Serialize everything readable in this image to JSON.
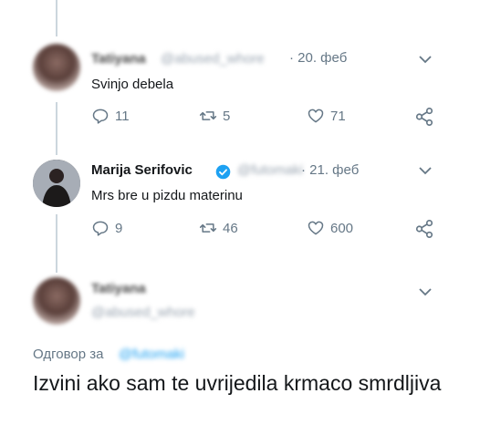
{
  "tweet1": {
    "name": "Tatiyana",
    "handle": "@abused_whore",
    "date": "· 20. феб",
    "text": "Svinjo debela",
    "replies": "11",
    "retweets": "5",
    "likes": "71"
  },
  "tweet2": {
    "name": "Marija Serifovic",
    "handle": "@futomaki",
    "date": "· 21. феб",
    "text": "Mrs bre u pizdu materinu",
    "replies": "9",
    "retweets": "46",
    "likes": "600"
  },
  "tweet3": {
    "name": "Tatiyana",
    "handle": "@abused_whore",
    "reply_label": "Одговор за",
    "reply_handle": "@futomaki",
    "text": "Izvini ako sam te uvrijedila krmaco smrdljiva"
  },
  "colors": {
    "accent": "#1da1f2",
    "muted": "#657786",
    "text": "#14171a"
  },
  "icons": [
    "reply-icon",
    "retweet-icon",
    "like-icon",
    "share-icon",
    "chevron-down-icon",
    "verified-icon"
  ]
}
